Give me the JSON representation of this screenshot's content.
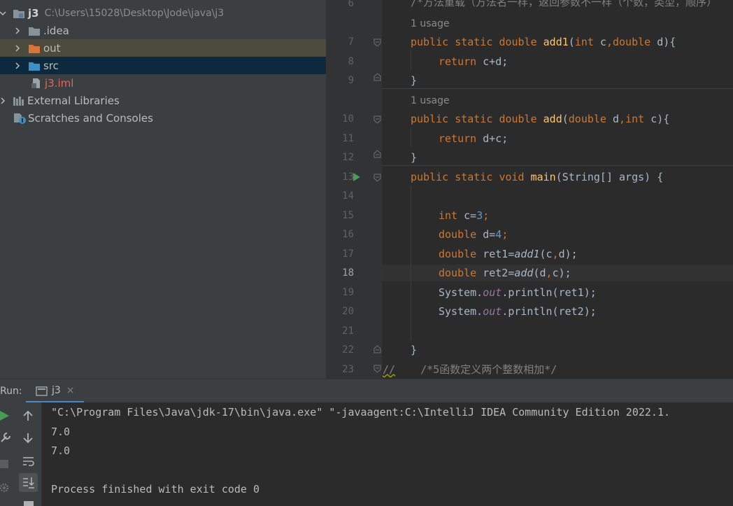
{
  "project_tree": {
    "root": {
      "name": "j3",
      "path": "C:\\Users\\15028\\Desktop\\Jode\\java\\j3"
    },
    "items": [
      {
        "label": ".idea"
      },
      {
        "label": "out"
      },
      {
        "label": "src"
      },
      {
        "label": "j3.iml"
      }
    ],
    "external_libraries": "External Libraries",
    "scratches": "Scratches and Consoles"
  },
  "editor": {
    "top_partial": "/*方法重载（方法名一样，返回参数不一样（个数，类型，顺序）",
    "usage_hint": "1 usage",
    "line_numbers": [
      "6",
      "7",
      "8",
      "9",
      "10",
      "11",
      "12",
      "13",
      "14",
      "15",
      "16",
      "17",
      "18",
      "19",
      "20",
      "21",
      "22",
      "23"
    ],
    "current_line": "18",
    "code": {
      "l7": [
        "public",
        "static",
        "double",
        "add1",
        "int",
        "c",
        "double",
        "d){"
      ],
      "l8": [
        "return",
        "c+d;"
      ],
      "l9": "}",
      "l10": [
        "public",
        "static",
        "double",
        "add",
        "double",
        "d",
        "int",
        "c){"
      ],
      "l11": [
        "return",
        "d+c;"
      ],
      "l12": "}",
      "l13": [
        "public",
        "static",
        "void",
        "main",
        "(String[] args) {"
      ],
      "l15": [
        "int",
        "c=",
        "3",
        ";"
      ],
      "l16": [
        "double",
        "d=",
        "4",
        ";"
      ],
      "l17": [
        "double",
        "ret1=",
        "add1",
        "(c",
        ",",
        "d);"
      ],
      "l18": [
        "double",
        "ret2=",
        "add",
        "(d",
        ",",
        "c);"
      ],
      "l19": [
        "System.",
        "out",
        ".println(ret1);"
      ],
      "l20": [
        "System.",
        "out",
        ".println(ret2);"
      ],
      "l22": "}",
      "l23": [
        "//",
        "/*5函数定义两个整数相加*/"
      ]
    }
  },
  "run_panel": {
    "label": "Run:",
    "tab": "j3",
    "close": "×",
    "console_lines": [
      "\"C:\\Program Files\\Java\\jdk-17\\bin\\java.exe\" \"-javaagent:C:\\IntelliJ IDEA Community Edition 2022.1.",
      "7.0",
      "7.0",
      "",
      "Process finished with exit code 0"
    ]
  },
  "colors": {
    "keyword": "#cc7832",
    "function": "#ffc66d",
    "number": "#6897bb",
    "static_field": "#9876aa",
    "iml_file": "#e0665b",
    "accent": "#4a88c7"
  }
}
